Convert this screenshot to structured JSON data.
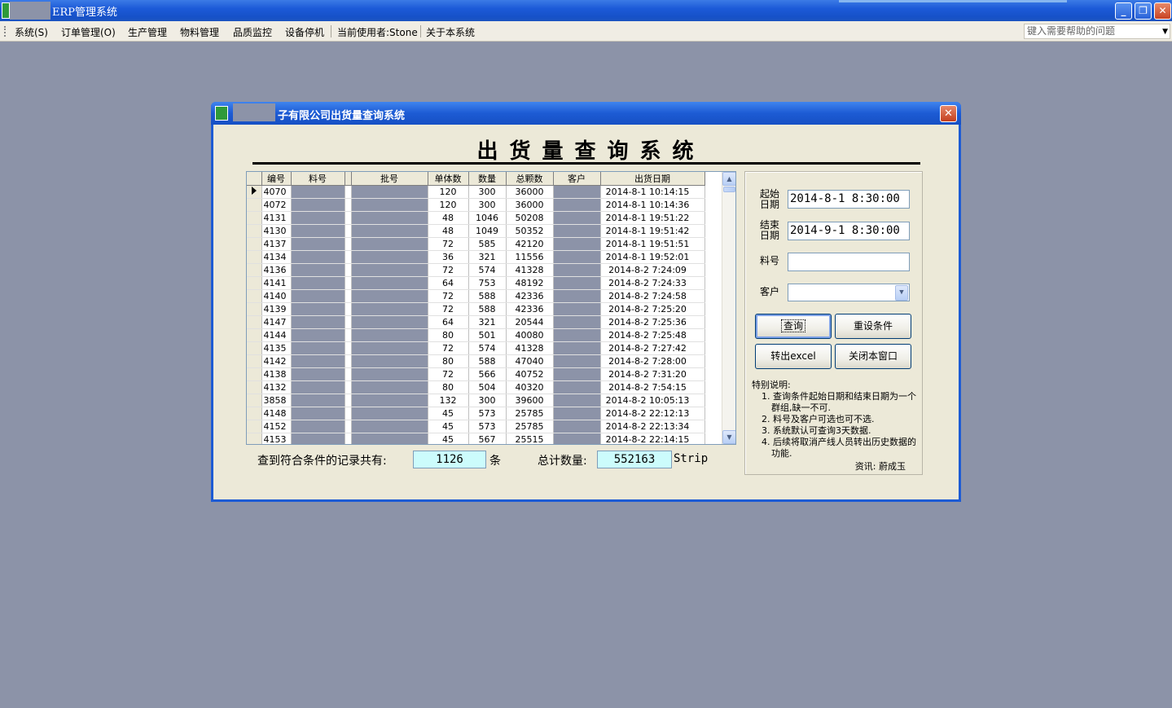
{
  "app": {
    "title": "ERP管理系统",
    "min": "_",
    "restore": "❐",
    "close": "✕"
  },
  "menu": {
    "items": [
      "系统(S)",
      "订单管理(O)",
      "生产管理",
      "物料管理",
      "品质监控",
      "设备停机",
      "当前使用者:Stone",
      "关于本系统"
    ],
    "help_placeholder": "键入需要帮助的问题"
  },
  "dialog": {
    "title": "子有限公司出货量查询系统",
    "close": "✕",
    "heading": "出货量查询系统"
  },
  "grid": {
    "columns": [
      "编号",
      "料号",
      "批号",
      "单体数",
      "数量",
      "总颗数",
      "客户",
      "出货日期"
    ],
    "rows": [
      [
        "4070",
        "",
        "",
        "120",
        "300",
        "36000",
        "",
        "2014-8-1 10:14:15"
      ],
      [
        "4072",
        "",
        "",
        "120",
        "300",
        "36000",
        "",
        "2014-8-1 10:14:36"
      ],
      [
        "4131",
        "",
        "",
        "48",
        "1046",
        "50208",
        "",
        "2014-8-1 19:51:22"
      ],
      [
        "4130",
        "",
        "",
        "48",
        "1049",
        "50352",
        "",
        "2014-8-1 19:51:42"
      ],
      [
        "4137",
        "",
        "",
        "72",
        "585",
        "42120",
        "",
        "2014-8-1 19:51:51"
      ],
      [
        "4134",
        "",
        "",
        "36",
        "321",
        "11556",
        "",
        "2014-8-1 19:52:01"
      ],
      [
        "4136",
        "",
        "",
        "72",
        "574",
        "41328",
        "",
        "2014-8-2 7:24:09"
      ],
      [
        "4141",
        "",
        "",
        "64",
        "753",
        "48192",
        "",
        "2014-8-2 7:24:33"
      ],
      [
        "4140",
        "",
        "",
        "72",
        "588",
        "42336",
        "",
        "2014-8-2 7:24:58"
      ],
      [
        "4139",
        "",
        "",
        "72",
        "588",
        "42336",
        "",
        "2014-8-2 7:25:20"
      ],
      [
        "4147",
        "",
        "",
        "64",
        "321",
        "20544",
        "",
        "2014-8-2 7:25:36"
      ],
      [
        "4144",
        "",
        "",
        "80",
        "501",
        "40080",
        "",
        "2014-8-2 7:25:48"
      ],
      [
        "4135",
        "",
        "",
        "72",
        "574",
        "41328",
        "",
        "2014-8-2 7:27:42"
      ],
      [
        "4142",
        "",
        "",
        "80",
        "588",
        "47040",
        "",
        "2014-8-2 7:28:00"
      ],
      [
        "4138",
        "",
        "",
        "72",
        "566",
        "40752",
        "",
        "2014-8-2 7:31:20"
      ],
      [
        "4132",
        "",
        "",
        "80",
        "504",
        "40320",
        "",
        "2014-8-2 7:54:15"
      ],
      [
        "3858",
        "",
        "",
        "132",
        "300",
        "39600",
        "",
        "2014-8-2 10:05:13"
      ],
      [
        "4148",
        "",
        "",
        "45",
        "573",
        "25785",
        "",
        "2014-8-2 22:12:13"
      ],
      [
        "4152",
        "",
        "",
        "45",
        "573",
        "25785",
        "",
        "2014-8-2 22:13:34"
      ],
      [
        "4153",
        "",
        "",
        "45",
        "567",
        "25515",
        "",
        "2014-8-2 22:14:15"
      ]
    ],
    "scroll_up": "▲",
    "scroll_down": "▼"
  },
  "summary": {
    "records_label": "查到符合条件的记录共有:",
    "records_value": "1126",
    "records_unit": "条",
    "total_label": "总计数量:",
    "total_value": "552163",
    "total_unit": "Strip"
  },
  "form": {
    "start_label": "起始日期",
    "start_value": "2014-8-1  8:30:00",
    "end_label": "结束日期",
    "end_value": "2014-9-1  8:30:00",
    "part_label": "料号",
    "part_value": "",
    "customer_label": "客户",
    "customer_value": "",
    "query_button": "查询",
    "reset_button": "重设条件",
    "export_button": "转出excel",
    "close_button": "关闭本窗口"
  },
  "notes": {
    "title": "特别说明:",
    "items": [
      "1. 查询条件起始日期和结束日期为一个群组,缺一不可.",
      "2. 料号及客户可选也可不选.",
      "3. 系统默认可查询3天数据.",
      "4. 后续将取消产线人员转出历史数据的功能."
    ],
    "author": "资讯: 蔚成玉"
  },
  "colors": {
    "titlebar": "#1d5bd4",
    "desktop": "#8c93a8",
    "dialog_bg": "#ece9d8",
    "highlight_box": "#ccfcfc"
  }
}
